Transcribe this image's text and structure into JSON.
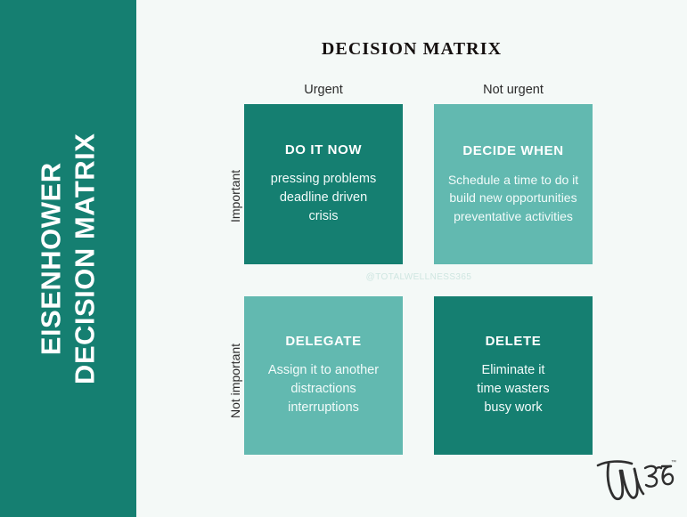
{
  "sidebar": {
    "title_line1": "EISENHOWER",
    "title_line2": "DECISION MATRIX"
  },
  "header": {
    "title": "DECISION MATRIX"
  },
  "axes": {
    "columns": [
      {
        "label": "Urgent"
      },
      {
        "label": "Not urgent"
      }
    ],
    "rows": [
      {
        "label": "Important"
      },
      {
        "label": "Not important"
      }
    ]
  },
  "quadrants": [
    {
      "id": "do-it-now",
      "title": "DO IT NOW",
      "items": [
        "pressing problems",
        "deadline driven",
        "crisis"
      ],
      "color": "#157f71",
      "urgency": "Urgent",
      "importance": "Important"
    },
    {
      "id": "decide-when",
      "title": "DECIDE WHEN",
      "items": [
        "Schedule a time to do it",
        "build new opportunities",
        "preventative activities"
      ],
      "color": "#62b9b0",
      "urgency": "Not urgent",
      "importance": "Important"
    },
    {
      "id": "delegate",
      "title": "DELEGATE",
      "items": [
        "Assign it to another",
        "distractions",
        "interruptions"
      ],
      "color": "#62b9b0",
      "urgency": "Urgent",
      "importance": "Not important"
    },
    {
      "id": "delete",
      "title": "DELETE",
      "items": [
        "Eliminate it",
        "time wasters",
        "busy work"
      ],
      "color": "#157f71",
      "urgency": "Not urgent",
      "importance": "Not important"
    }
  ],
  "watermark": {
    "text": "@TOTALWELLNESS365"
  },
  "logo": {
    "mark": "TW365",
    "trademark": "™"
  },
  "colors": {
    "dark_teal": "#157f71",
    "light_teal": "#62b9b0",
    "background": "#f4f9f7",
    "text_dark": "#15100f",
    "text_on_teal": "#ffffff",
    "watermark": "#cfe6e1"
  }
}
